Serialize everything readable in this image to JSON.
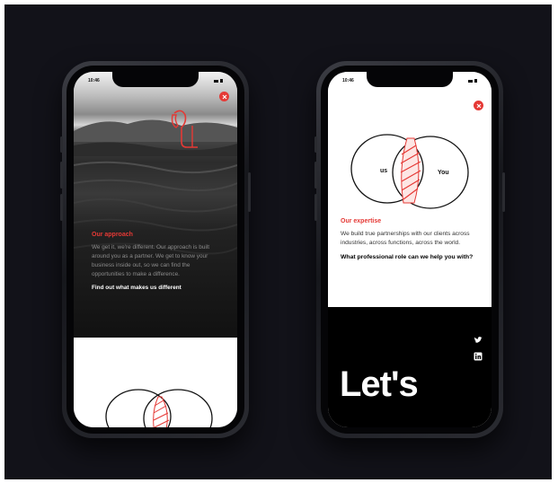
{
  "phones": [
    {
      "status_time": "10:46",
      "eyebrow": "Our approach",
      "body": "We get it, we're different. Our approach is built around you as a partner. We get to know your business inside out, so we can find the opportunities to make a difference.",
      "cta": "Find out what makes us different"
    },
    {
      "status_time": "10:46",
      "venn_left": "us",
      "venn_right": "You",
      "eyebrow": "Our expertise",
      "body": "We build true partnerships with our clients across industries, across functions, across the world.",
      "question": "What professional role can we help you with?",
      "heading": "Let's"
    }
  ],
  "colors": {
    "accent": "#e53935",
    "background": "#121219",
    "footer": "#000000"
  },
  "icons": [
    "close-icon",
    "twitter-icon",
    "linkedin-icon"
  ]
}
